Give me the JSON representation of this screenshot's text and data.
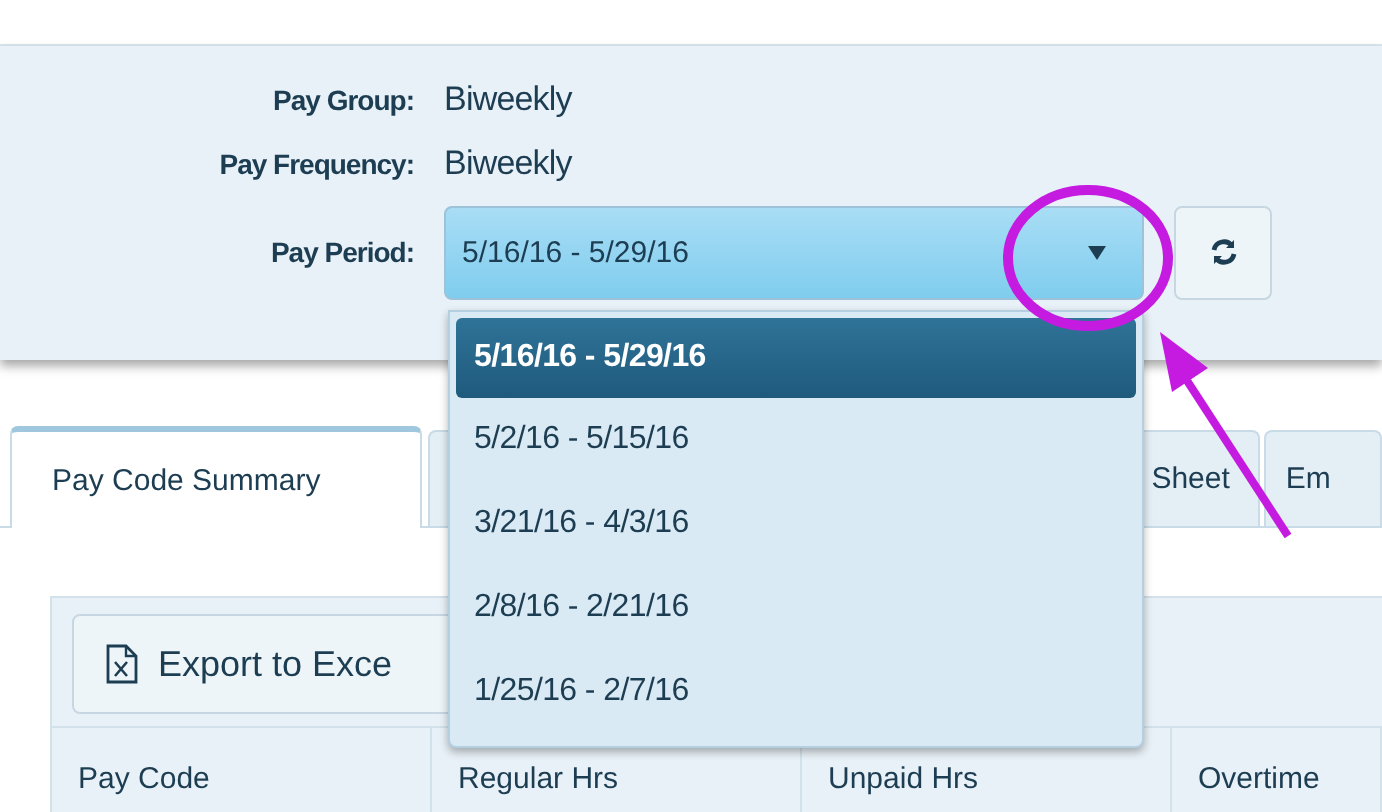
{
  "header": {
    "fields": [
      {
        "label": "Pay Group:",
        "value": "Biweekly"
      },
      {
        "label": "Pay Frequency:",
        "value": "Biweekly"
      }
    ],
    "pay_period": {
      "label": "Pay Period:",
      "value": "5/16/16 - 5/29/16",
      "expanded": true
    }
  },
  "pay_period_options": [
    {
      "label": "5/16/16 - 5/29/16",
      "selected": true
    },
    {
      "label": "5/2/16 - 5/15/16",
      "selected": false
    },
    {
      "label": "3/21/16 - 4/3/16",
      "selected": false
    },
    {
      "label": "2/8/16 - 2/21/16",
      "selected": false
    },
    {
      "label": "1/25/16 - 2/7/16",
      "selected": false
    }
  ],
  "tabs": [
    {
      "label": "Pay Code Summary",
      "selected": true
    },
    {
      "label": "Sheet",
      "selected": false
    },
    {
      "label": "Em",
      "selected": false
    }
  ],
  "export_button": {
    "label": "Export to Exce"
  },
  "table": {
    "columns": [
      "Pay Code",
      "Regular Hrs",
      "Unpaid Hrs",
      "Overtime"
    ]
  }
}
